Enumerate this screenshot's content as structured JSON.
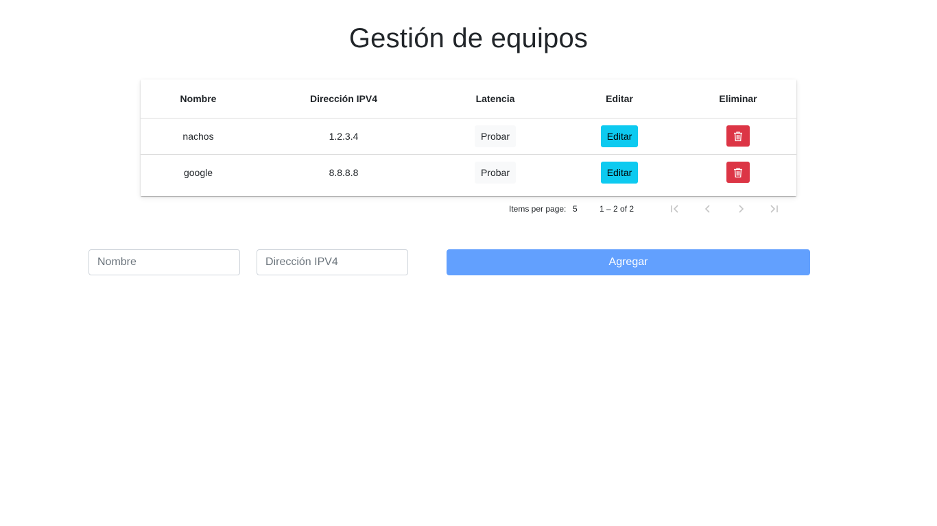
{
  "page": {
    "title": "Gestión de equipos"
  },
  "table": {
    "headers": [
      "Nombre",
      "Dirección IPV4",
      "Latencia",
      "Editar",
      "Eliminar"
    ],
    "rows": [
      {
        "nombre": "nachos",
        "ip": "1.2.3.4",
        "latency_label": "Probar",
        "edit_label": "Editar",
        "delete_icon": "trash-icon"
      },
      {
        "nombre": "google",
        "ip": "8.8.8.8",
        "latency_label": "Probar",
        "edit_label": "Editar",
        "delete_icon": "trash-icon"
      }
    ]
  },
  "paginator": {
    "items_per_page_label": "Items per page:",
    "page_size": "5",
    "range_label": "1 – 2 of 2",
    "icons": [
      "first-page-icon",
      "previous-page-icon",
      "next-page-icon",
      "last-page-icon"
    ]
  },
  "form": {
    "nombre_placeholder": "Nombre",
    "ip_placeholder": "Dirección IPV4",
    "add_label": "Agregar"
  },
  "colors": {
    "edit_button": "#0dcaf0",
    "delete_button": "#dc3545",
    "add_button": "#62a0fe",
    "probar_button": "#f8f9fa"
  }
}
